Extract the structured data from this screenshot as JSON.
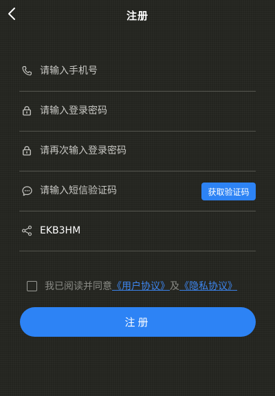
{
  "header": {
    "title": "注册",
    "back_icon": "chevron-left-icon"
  },
  "form": {
    "phone": {
      "icon": "phone-icon",
      "placeholder": "请输入手机号",
      "value": ""
    },
    "password": {
      "icon": "lock-icon",
      "placeholder": "请输入登录密码",
      "value": ""
    },
    "confirm_password": {
      "icon": "lock-icon",
      "placeholder": "请再次输入登录密码",
      "value": ""
    },
    "sms_code": {
      "icon": "chat-bubble-icon",
      "placeholder": "请输入短信验证码",
      "value": "",
      "button_label": "获取验证码"
    },
    "invite_code": {
      "icon": "share-icon",
      "placeholder": "",
      "value": "EKB3HM"
    }
  },
  "agreement": {
    "prefix": "我已阅读并同意",
    "user_agreement": "《用户协议》",
    "connector": "及",
    "privacy_policy": "《隐私协议》",
    "checked": false
  },
  "submit": {
    "label": "注册"
  },
  "colors": {
    "background": "#23241f",
    "accent": "#2d83f5",
    "link": "#3d86f0",
    "divider": "#55564f"
  }
}
